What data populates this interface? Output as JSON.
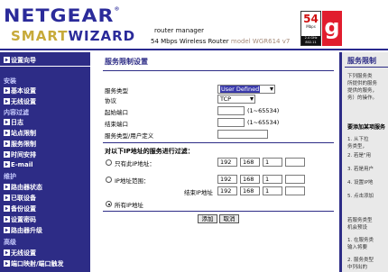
{
  "header": {
    "brand_top": "NETGEAR",
    "brand_smart": "SMART",
    "brand_wizard": "WIZARD",
    "reg_mark": "®",
    "product_title": "router manager",
    "product_desc": "54 Mbps Wireless Router",
    "product_model": " model WGR614 v7",
    "badge": {
      "speed": "54",
      "unit": "Mbps",
      "line1": "2.4 GHz",
      "line2": "802.11",
      "g": "g"
    }
  },
  "nav": {
    "items": [
      {
        "label": "设置向导"
      },
      {
        "label": "安装",
        "section": true
      },
      {
        "label": "基本设置"
      },
      {
        "label": "无线设置"
      },
      {
        "label": "内容过滤",
        "section": true
      },
      {
        "label": "日志"
      },
      {
        "label": "站点限制"
      },
      {
        "label": "服务限制"
      },
      {
        "label": "时间安排"
      },
      {
        "label": "E-mail"
      },
      {
        "label": "维护",
        "section": true
      },
      {
        "label": "路由器状态"
      },
      {
        "label": "已联设备"
      },
      {
        "label": "备份设置"
      },
      {
        "label": "设置密码"
      },
      {
        "label": "路由器升级"
      },
      {
        "label": "高级",
        "section": true
      },
      {
        "label": "无线设置"
      },
      {
        "label": "端口映射/端口触发"
      }
    ]
  },
  "main": {
    "title": "服务限制设置",
    "fields": {
      "service_type_label": "服务类型",
      "service_type_value": "User Defined",
      "protocol_label": "协议",
      "protocol_value": "TCP",
      "start_port_label": "起始端口",
      "start_port_hint": "(1~65534)",
      "end_port_label": "结束端口",
      "end_port_hint": "(1~65534)",
      "custom_label": "服务类型/用户定义"
    },
    "filter_heading": "对以下IP地址的服务进行过滤：",
    "options": {
      "single_label": "只有此IP地址：",
      "range_label": "IP地址范围：",
      "range_end_label": "结束IP地址",
      "all_label": "所有IP地址"
    },
    "ip_single": [
      "192",
      "168",
      "1",
      ""
    ],
    "ip_range_start": [
      "192",
      "168",
      "1",
      ""
    ],
    "ip_range_end": [
      "192",
      "168",
      "1",
      ""
    ],
    "buttons": {
      "add": "添加",
      "cancel": "取消"
    }
  },
  "help": {
    "title": "服务限制",
    "lines": [
      "下列服务类",
      "所提供的服务",
      "提供的服务，",
      "务）的操作。"
    ],
    "section": "要添加某项服务",
    "steps": [
      "1. 从下拉",
      "务类型，",
      "2. 若是\"用",
      "3. 若是用户",
      "4. 设置IP地",
      "5. 点击添加"
    ],
    "footer_lines": [
      "若服务类型",
      "机会预设",
      "1. 在服务类",
      "输入将要",
      "2. 服务类型",
      "中列出的"
    ]
  },
  "colors": {
    "nav_bg": "#2d2c86",
    "accent": "#2b2b9a",
    "gold": "#c7aa3a",
    "badge_red": "#e11d2e"
  }
}
